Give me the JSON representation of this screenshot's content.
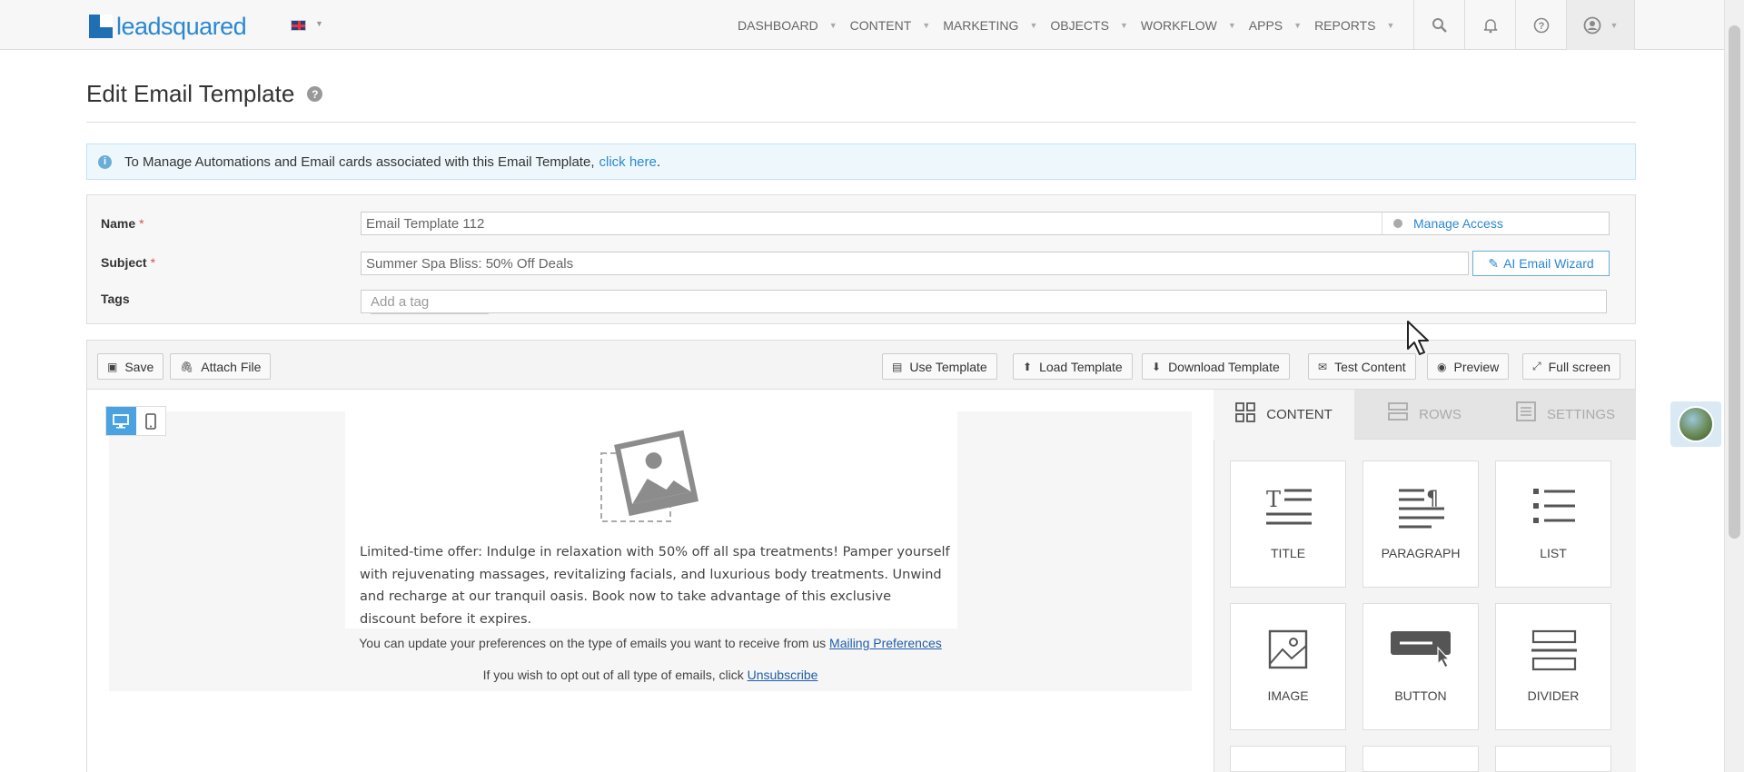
{
  "app": {
    "logo_text": "leadsquared"
  },
  "nav": {
    "items": [
      "DASHBOARD",
      "CONTENT",
      "MARKETING",
      "OBJECTS",
      "WORKFLOW",
      "APPS",
      "REPORTS"
    ],
    "icons": [
      "search-icon",
      "bell-icon",
      "help-icon",
      "user-icon"
    ]
  },
  "page": {
    "title": "Edit Email Template"
  },
  "info": {
    "text": "To Manage Automations and Email cards associated with this Email Template,",
    "link": "click here",
    "suffix": "."
  },
  "form": {
    "name_label": "Name",
    "name_value": "Email Template 112",
    "manage_access": "Manage Access",
    "subject_label": "Subject",
    "subject_value": "Summer Spa Bliss: 50% Off Deals",
    "ai_wizard": "AI Email Wizard",
    "tags_label": "Tags",
    "tags_placeholder": "Add a tag",
    "required_mark": "*"
  },
  "toolbar": {
    "save": "Save",
    "attach": "Attach File",
    "use_template": "Use Template",
    "load_template": "Load Template",
    "download_template": "Download Template",
    "test_content": "Test Content",
    "preview": "Preview",
    "full_screen": "Full screen"
  },
  "email": {
    "body": "Limited-time offer: Indulge in relaxation with 50% off all spa treatments! Pamper yourself with rejuvenating massages, revitalizing facials, and luxurious body treatments. Unwind and recharge at our tranquil oasis. Book now to take advantage of this exclusive discount before it expires.",
    "pref_text": "You can update your preferences on the type of emails you want to receive from us",
    "pref_link": "Mailing Preferences",
    "optout_text": "If you wish to opt out of all type of emails, click",
    "optout_link": "Unsubscribe"
  },
  "panel": {
    "tabs": [
      "CONTENT",
      "ROWS",
      "SETTINGS"
    ],
    "tiles": [
      "TITLE",
      "PARAGRAPH",
      "LIST",
      "IMAGE",
      "BUTTON",
      "DIVIDER"
    ]
  },
  "colors": {
    "accent": "#2a88d0",
    "device_active": "#4aa3e0",
    "required": "#d9534f"
  }
}
